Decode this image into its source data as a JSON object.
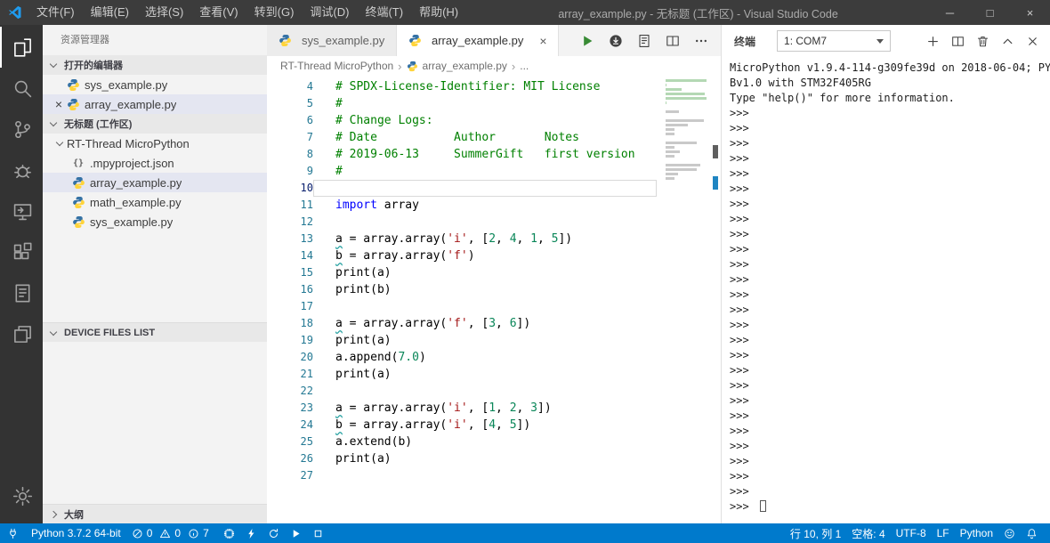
{
  "title_bar": {
    "menus": [
      "文件(F)",
      "编辑(E)",
      "选择(S)",
      "查看(V)",
      "转到(G)",
      "调试(D)",
      "终端(T)",
      "帮助(H)"
    ],
    "title": "array_example.py - 无标题 (工作区) - Visual Studio Code",
    "window_controls": {
      "minimize": "─",
      "maximize": "□",
      "close": "×"
    }
  },
  "activity_bar": {
    "items": [
      {
        "name": "explorer",
        "active": true
      },
      {
        "name": "search",
        "active": false
      },
      {
        "name": "source-control",
        "active": false
      },
      {
        "name": "debug",
        "active": false
      },
      {
        "name": "remote",
        "active": false
      },
      {
        "name": "extensions",
        "active": false
      },
      {
        "name": "notes",
        "active": false
      },
      {
        "name": "projects",
        "active": false
      }
    ],
    "bottom": [
      {
        "name": "settings",
        "active": false
      }
    ]
  },
  "sidebar": {
    "title": "资源管理器",
    "open_editors": {
      "label": "打开的编辑器",
      "items": [
        {
          "name": "sys_example.py",
          "icon": "python",
          "selected": false,
          "closable": false
        },
        {
          "name": "array_example.py",
          "icon": "python",
          "selected": true,
          "closable": true
        }
      ]
    },
    "workspace": {
      "label": "无标题 (工作区)",
      "folder": "RT-Thread MicroPython",
      "files": [
        {
          "name": ".mpyproject.json",
          "icon": "json",
          "selected": false
        },
        {
          "name": "array_example.py",
          "icon": "python",
          "selected": true
        },
        {
          "name": "math_example.py",
          "icon": "python",
          "selected": false
        },
        {
          "name": "sys_example.py",
          "icon": "python",
          "selected": false
        }
      ]
    },
    "device_files_label": "DEVICE FILES LIST",
    "outline_label": "大纲"
  },
  "editor": {
    "tabs": [
      {
        "label": "sys_example.py",
        "active": false
      },
      {
        "label": "array_example.py",
        "active": true
      }
    ],
    "breadcrumb": [
      "RT-Thread MicroPython",
      "array_example.py",
      "..."
    ],
    "code_lines": [
      {
        "n": 4,
        "t": [
          [
            "c",
            "# SPDX-License-Identifier: MIT License"
          ]
        ]
      },
      {
        "n": 5,
        "t": [
          [
            "c",
            "#"
          ]
        ]
      },
      {
        "n": 6,
        "t": [
          [
            "c",
            "# Change Logs:"
          ]
        ]
      },
      {
        "n": 7,
        "t": [
          [
            "c",
            "# Date           Author       Notes"
          ]
        ]
      },
      {
        "n": 8,
        "t": [
          [
            "c",
            "# 2019-06-13     SummerGift   first version"
          ]
        ]
      },
      {
        "n": 9,
        "t": [
          [
            "c",
            "#"
          ]
        ]
      },
      {
        "n": 10,
        "t": [],
        "cur": true
      },
      {
        "n": 11,
        "t": [
          [
            "k",
            "import"
          ],
          [
            "p",
            " array"
          ]
        ]
      },
      {
        "n": 12,
        "t": []
      },
      {
        "n": 13,
        "t": [
          [
            "u",
            "a"
          ],
          [
            "p",
            " = array.array("
          ],
          [
            "s",
            "'i'"
          ],
          [
            "p",
            ", ["
          ],
          [
            "m",
            "2"
          ],
          [
            "p",
            ", "
          ],
          [
            "m",
            "4"
          ],
          [
            "p",
            ", "
          ],
          [
            "m",
            "1"
          ],
          [
            "p",
            ", "
          ],
          [
            "m",
            "5"
          ],
          [
            "p",
            "])"
          ]
        ]
      },
      {
        "n": 14,
        "t": [
          [
            "u",
            "b"
          ],
          [
            "p",
            " = array.array("
          ],
          [
            "s",
            "'f'"
          ],
          [
            "p",
            ")"
          ]
        ]
      },
      {
        "n": 15,
        "t": [
          [
            "p",
            "print(a)"
          ]
        ]
      },
      {
        "n": 16,
        "t": [
          [
            "p",
            "print(b)"
          ]
        ]
      },
      {
        "n": 17,
        "t": []
      },
      {
        "n": 18,
        "t": [
          [
            "u",
            "a"
          ],
          [
            "p",
            " = array.array("
          ],
          [
            "s",
            "'f'"
          ],
          [
            "p",
            ", ["
          ],
          [
            "m",
            "3"
          ],
          [
            "p",
            ", "
          ],
          [
            "m",
            "6"
          ],
          [
            "p",
            "])"
          ]
        ]
      },
      {
        "n": 19,
        "t": [
          [
            "p",
            "print(a)"
          ]
        ]
      },
      {
        "n": 20,
        "t": [
          [
            "p",
            "a.append("
          ],
          [
            "m",
            "7.0"
          ],
          [
            "p",
            ")"
          ]
        ]
      },
      {
        "n": 21,
        "t": [
          [
            "p",
            "print(a)"
          ]
        ]
      },
      {
        "n": 22,
        "t": []
      },
      {
        "n": 23,
        "t": [
          [
            "u",
            "a"
          ],
          [
            "p",
            " = array.array("
          ],
          [
            "s",
            "'i'"
          ],
          [
            "p",
            ", ["
          ],
          [
            "m",
            "1"
          ],
          [
            "p",
            ", "
          ],
          [
            "m",
            "2"
          ],
          [
            "p",
            ", "
          ],
          [
            "m",
            "3"
          ],
          [
            "p",
            "])"
          ]
        ]
      },
      {
        "n": 24,
        "t": [
          [
            "u",
            "b"
          ],
          [
            "p",
            " = array.array("
          ],
          [
            "s",
            "'i'"
          ],
          [
            "p",
            ", ["
          ],
          [
            "m",
            "4"
          ],
          [
            "p",
            ", "
          ],
          [
            "m",
            "5"
          ],
          [
            "p",
            "])"
          ]
        ]
      },
      {
        "n": 25,
        "t": [
          [
            "p",
            "a.extend(b)"
          ]
        ]
      },
      {
        "n": 26,
        "t": [
          [
            "p",
            "print(a)"
          ]
        ]
      },
      {
        "n": 27,
        "t": []
      }
    ]
  },
  "terminal": {
    "tab_label": "终端",
    "selector_value": "1: COM7",
    "intro_lines": [
      "MicroPython v1.9.4-114-g309fe39d on 2018-06-04; PY",
      "Bv1.0 with STM32F405RG",
      "Type \"help()\" for more information."
    ],
    "prompt": ">>>",
    "prompt_count": 26
  },
  "status_bar": {
    "interpreter": "Python 3.7.2 64-bit",
    "errors": "0",
    "warnings": "0",
    "infos": "7",
    "line_col": "行 10, 列 1",
    "indent": "空格: 4",
    "encoding": "UTF-8",
    "eol": "LF",
    "language": "Python"
  }
}
